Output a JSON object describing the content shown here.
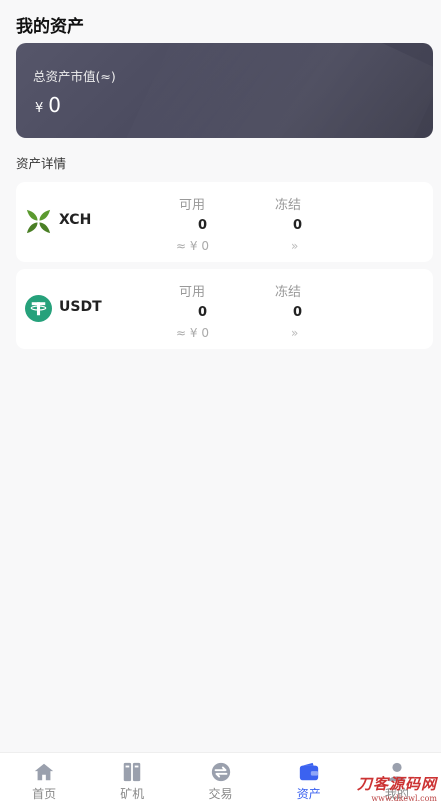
{
  "header": {
    "title": "我的资产"
  },
  "total": {
    "label": "总资产市值(≈)",
    "currency": "¥",
    "amount": "0"
  },
  "section": {
    "label": "资产详情"
  },
  "assets": [
    {
      "name": "XCH",
      "available_label": "可用",
      "frozen_label": "冻结",
      "available": "0",
      "frozen": "0",
      "approx": "≈ ¥ 0",
      "more": "»",
      "icon": "xch-logo-icon",
      "color": "#4a8a2c"
    },
    {
      "name": "USDT",
      "available_label": "可用",
      "frozen_label": "冻结",
      "available": "0",
      "frozen": "0",
      "approx": "≈ ¥ 0",
      "more": "»",
      "icon": "tether-logo-icon",
      "color": "#26a17b"
    }
  ],
  "tabbar": {
    "items": [
      {
        "label": "首页",
        "icon": "home-icon"
      },
      {
        "label": "矿机",
        "icon": "miner-icon"
      },
      {
        "label": "交易",
        "icon": "exchange-icon"
      },
      {
        "label": "资产",
        "icon": "wallet-icon",
        "active": true
      },
      {
        "label": "我的",
        "icon": "user-icon"
      }
    ],
    "active_color": "#3b62f0",
    "inactive_color": "#9aa0ad"
  },
  "watermark": {
    "main": "刀客源码网",
    "sub": "www.dkewl.com"
  }
}
